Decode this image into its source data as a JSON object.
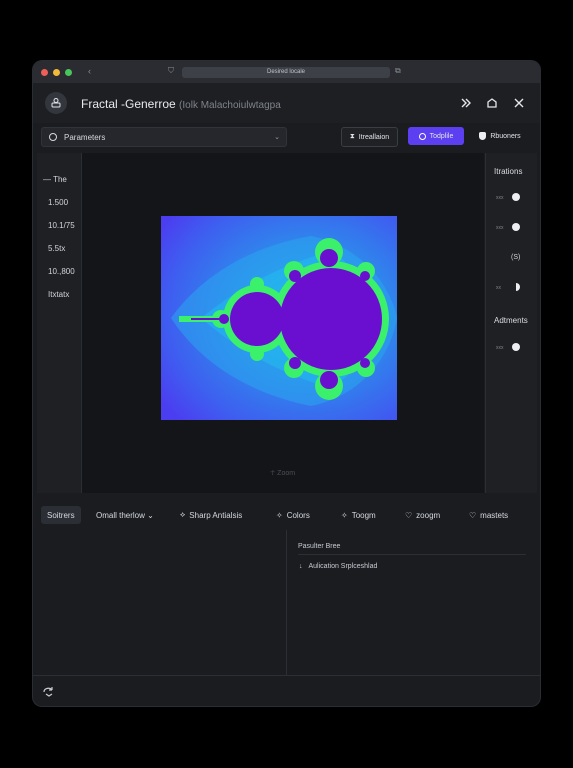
{
  "browser": {
    "url_text": "Desired locale"
  },
  "app": {
    "title": "Fractal -Generroe",
    "subtitle": "(Iolk Malachoiulwtagpa"
  },
  "toolbar": {
    "parameters_label": "Parameters",
    "iteration_label": "Itreallaion",
    "topple_label": "Todplile",
    "renderers_label": "Rbuoners"
  },
  "stats": [
    "The",
    "1.500",
    "10.1/75",
    "5.5tx",
    "10.,800",
    "Itxtatx"
  ],
  "right_panel": {
    "iterations_heading": "Itrations",
    "rows": [
      {
        "label": "xxx",
        "state": "on"
      },
      {
        "label": "xxx",
        "state": "on"
      }
    ],
    "value": "(S)",
    "row3": {
      "label": "xx",
      "state": "half"
    },
    "adjustments_heading": "Adtments",
    "row4": {
      "label": "xxx",
      "state": "on"
    }
  },
  "canvas": {
    "zoom_hint": "☥ Zoom"
  },
  "tabs": [
    {
      "label": "Soitrers",
      "icon": "",
      "active": true
    },
    {
      "label": "Omall therlow ⌄",
      "icon": "",
      "active": false
    },
    {
      "label": "Sharp Antialsis",
      "icon": "wand-icon",
      "active": false
    },
    {
      "label": "Colors",
      "icon": "sparkle-icon",
      "active": false
    },
    {
      "label": "Toogm",
      "icon": "sparkle-icon",
      "active": false
    },
    {
      "label": "zoogm",
      "icon": "heart-icon",
      "active": false
    },
    {
      "label": "mastets",
      "icon": "heart-icon",
      "active": false
    }
  ],
  "bottom_right": {
    "title": "Pasulter Bree",
    "item": "Aulication Srplceshlad"
  },
  "colors": {
    "accent": "#5b3ff0",
    "fractal_body": "#6a0fd0",
    "fractal_edge": "#3bf06b",
    "fractal_bg_outer": "#4a3ef0",
    "fractal_bg_inner": "#2f7fe8"
  }
}
